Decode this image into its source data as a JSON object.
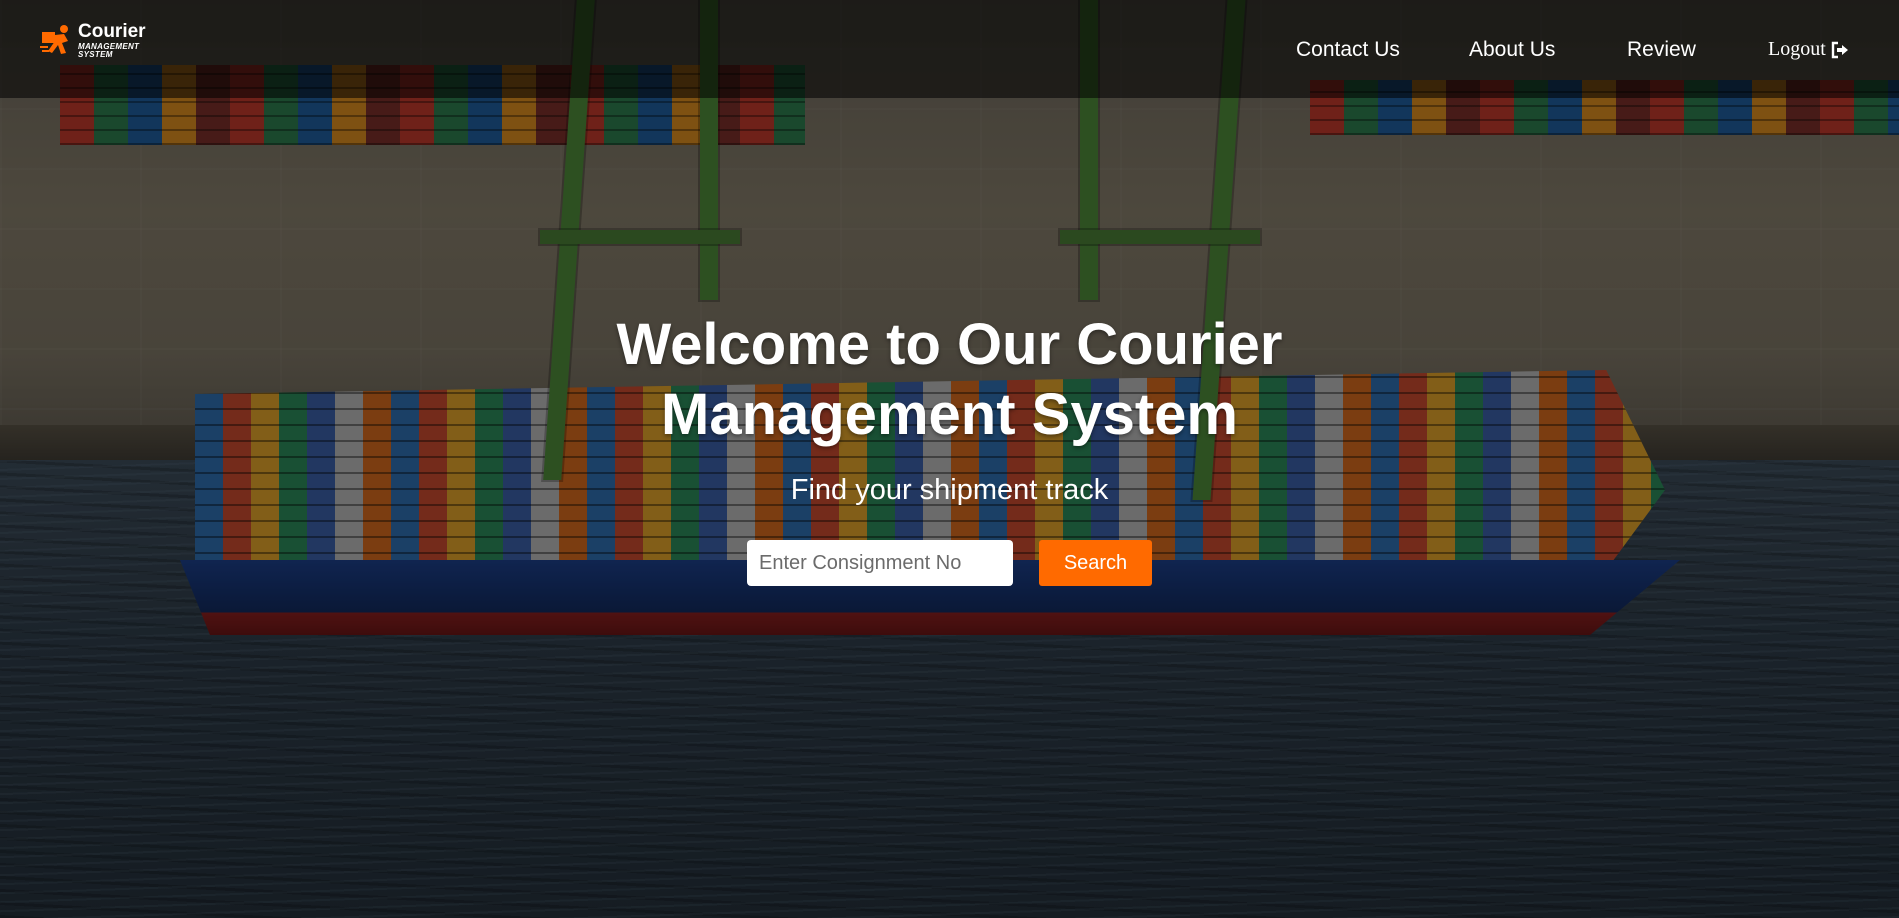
{
  "brand": {
    "name": "Courier",
    "tagline_line1": "MANAGEMENT",
    "tagline_line2": "SYSTEM",
    "icon": "courier-runner-icon",
    "accent_color": "#ff6a00"
  },
  "nav": {
    "contact": "Contact Us",
    "about": "About Us",
    "review": "Review",
    "logout": "Logout",
    "logout_icon": "sign-out-icon"
  },
  "hero": {
    "title": "Welcome to Our Courier Management System",
    "subtitle": "Find your shipment track",
    "background": "container-ship-port-photo"
  },
  "search": {
    "placeholder": "Enter Consignment No",
    "value": "",
    "button_label": "Search",
    "button_color": "#ff6a00"
  }
}
